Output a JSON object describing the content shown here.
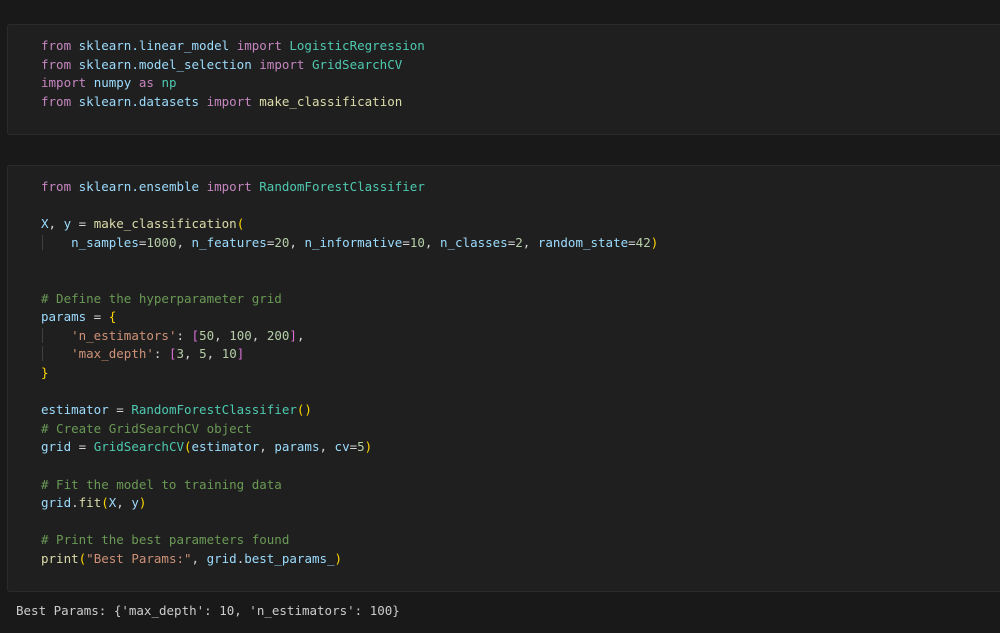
{
  "cell1": {
    "lines": [
      [
        {
          "t": "from",
          "c": "kw"
        },
        {
          "t": " ",
          "c": "plain"
        },
        {
          "t": "sklearn.linear_model",
          "c": "var"
        },
        {
          "t": " ",
          "c": "plain"
        },
        {
          "t": "import",
          "c": "kw"
        },
        {
          "t": " ",
          "c": "plain"
        },
        {
          "t": "LogisticRegression",
          "c": "cls"
        }
      ],
      [
        {
          "t": "from",
          "c": "kw"
        },
        {
          "t": " ",
          "c": "plain"
        },
        {
          "t": "sklearn.model_selection",
          "c": "var"
        },
        {
          "t": " ",
          "c": "plain"
        },
        {
          "t": "import",
          "c": "kw"
        },
        {
          "t": " ",
          "c": "plain"
        },
        {
          "t": "GridSearchCV",
          "c": "cls"
        }
      ],
      [
        {
          "t": "import",
          "c": "kw"
        },
        {
          "t": " ",
          "c": "plain"
        },
        {
          "t": "numpy",
          "c": "var"
        },
        {
          "t": " ",
          "c": "plain"
        },
        {
          "t": "as",
          "c": "kw"
        },
        {
          "t": " ",
          "c": "plain"
        },
        {
          "t": "np",
          "c": "cls"
        }
      ],
      [
        {
          "t": "from",
          "c": "kw"
        },
        {
          "t": " ",
          "c": "plain"
        },
        {
          "t": "sklearn.datasets",
          "c": "var"
        },
        {
          "t": " ",
          "c": "plain"
        },
        {
          "t": "import",
          "c": "kw"
        },
        {
          "t": " ",
          "c": "plain"
        },
        {
          "t": "make_classification",
          "c": "fn"
        }
      ]
    ]
  },
  "cell2": {
    "lines": [
      [
        {
          "t": "from",
          "c": "kw"
        },
        {
          "t": " ",
          "c": "plain"
        },
        {
          "t": "sklearn.ensemble",
          "c": "var"
        },
        {
          "t": " ",
          "c": "plain"
        },
        {
          "t": "import",
          "c": "kw"
        },
        {
          "t": " ",
          "c": "plain"
        },
        {
          "t": "RandomForestClassifier",
          "c": "cls"
        }
      ],
      [],
      [
        {
          "t": "X",
          "c": "var"
        },
        {
          "t": ", ",
          "c": "plain"
        },
        {
          "t": "y",
          "c": "var"
        },
        {
          "t": " = ",
          "c": "plain"
        },
        {
          "t": "make_classification",
          "c": "fn"
        },
        {
          "t": "(",
          "c": "brk"
        }
      ],
      [
        {
          "t": "    ",
          "c": "plain",
          "g": 1
        },
        {
          "t": "n_samples",
          "c": "var"
        },
        {
          "t": "=",
          "c": "plain"
        },
        {
          "t": "1000",
          "c": "num"
        },
        {
          "t": ", ",
          "c": "plain"
        },
        {
          "t": "n_features",
          "c": "var"
        },
        {
          "t": "=",
          "c": "plain"
        },
        {
          "t": "20",
          "c": "num"
        },
        {
          "t": ", ",
          "c": "plain"
        },
        {
          "t": "n_informative",
          "c": "var"
        },
        {
          "t": "=",
          "c": "plain"
        },
        {
          "t": "10",
          "c": "num"
        },
        {
          "t": ", ",
          "c": "plain"
        },
        {
          "t": "n_classes",
          "c": "var"
        },
        {
          "t": "=",
          "c": "plain"
        },
        {
          "t": "2",
          "c": "num"
        },
        {
          "t": ", ",
          "c": "plain"
        },
        {
          "t": "random_state",
          "c": "var"
        },
        {
          "t": "=",
          "c": "plain"
        },
        {
          "t": "42",
          "c": "num"
        },
        {
          "t": ")",
          "c": "brk"
        }
      ],
      [],
      [],
      [
        {
          "t": "# Define the hyperparameter grid",
          "c": "com"
        }
      ],
      [
        {
          "t": "params",
          "c": "var"
        },
        {
          "t": " = ",
          "c": "plain"
        },
        {
          "t": "{",
          "c": "brk"
        }
      ],
      [
        {
          "t": "    ",
          "c": "plain",
          "g": 1
        },
        {
          "t": "'n_estimators'",
          "c": "str"
        },
        {
          "t": ": ",
          "c": "plain"
        },
        {
          "t": "[",
          "c": "brk2"
        },
        {
          "t": "50",
          "c": "num"
        },
        {
          "t": ", ",
          "c": "plain"
        },
        {
          "t": "100",
          "c": "num"
        },
        {
          "t": ", ",
          "c": "plain"
        },
        {
          "t": "200",
          "c": "num"
        },
        {
          "t": "]",
          "c": "brk2"
        },
        {
          "t": ",",
          "c": "plain"
        }
      ],
      [
        {
          "t": "    ",
          "c": "plain",
          "g": 1
        },
        {
          "t": "'max_depth'",
          "c": "str"
        },
        {
          "t": ": ",
          "c": "plain"
        },
        {
          "t": "[",
          "c": "brk2"
        },
        {
          "t": "3",
          "c": "num"
        },
        {
          "t": ", ",
          "c": "plain"
        },
        {
          "t": "5",
          "c": "num"
        },
        {
          "t": ", ",
          "c": "plain"
        },
        {
          "t": "10",
          "c": "num"
        },
        {
          "t": "]",
          "c": "brk2"
        }
      ],
      [
        {
          "t": "}",
          "c": "brk"
        }
      ],
      [],
      [
        {
          "t": "estimator",
          "c": "var"
        },
        {
          "t": " = ",
          "c": "plain"
        },
        {
          "t": "RandomForestClassifier",
          "c": "cls"
        },
        {
          "t": "()",
          "c": "brk"
        }
      ],
      [
        {
          "t": "# Create GridSearchCV object",
          "c": "com"
        }
      ],
      [
        {
          "t": "grid",
          "c": "var"
        },
        {
          "t": " = ",
          "c": "plain"
        },
        {
          "t": "GridSearchCV",
          "c": "cls"
        },
        {
          "t": "(",
          "c": "brk"
        },
        {
          "t": "estimator",
          "c": "var"
        },
        {
          "t": ", ",
          "c": "plain"
        },
        {
          "t": "params",
          "c": "var"
        },
        {
          "t": ", ",
          "c": "plain"
        },
        {
          "t": "cv",
          "c": "var"
        },
        {
          "t": "=",
          "c": "plain"
        },
        {
          "t": "5",
          "c": "num"
        },
        {
          "t": ")",
          "c": "brk"
        }
      ],
      [],
      [
        {
          "t": "# Fit the model to training data",
          "c": "com"
        }
      ],
      [
        {
          "t": "grid",
          "c": "var"
        },
        {
          "t": ".",
          "c": "plain"
        },
        {
          "t": "fit",
          "c": "fn"
        },
        {
          "t": "(",
          "c": "brk"
        },
        {
          "t": "X",
          "c": "var"
        },
        {
          "t": ", ",
          "c": "plain"
        },
        {
          "t": "y",
          "c": "var"
        },
        {
          "t": ")",
          "c": "brk"
        }
      ],
      [],
      [
        {
          "t": "# Print the best parameters found",
          "c": "com"
        }
      ],
      [
        {
          "t": "print",
          "c": "fn"
        },
        {
          "t": "(",
          "c": "brk"
        },
        {
          "t": "\"Best Params:\"",
          "c": "str"
        },
        {
          "t": ", ",
          "c": "plain"
        },
        {
          "t": "grid",
          "c": "var"
        },
        {
          "t": ".",
          "c": "plain"
        },
        {
          "t": "best_params_",
          "c": "var"
        },
        {
          "t": ")",
          "c": "brk"
        }
      ]
    ]
  },
  "output": {
    "text": "Best Params: {'max_depth': 10, 'n_estimators': 100}"
  },
  "colors": {
    "background": "#191919",
    "cell_background": "#1f1f1f",
    "keyword": "#c586c0",
    "class": "#4ec9b0",
    "function": "#dcdcaa",
    "variable": "#9cdcfe",
    "number": "#b5cea8",
    "string": "#ce9178",
    "comment": "#6a9955"
  }
}
